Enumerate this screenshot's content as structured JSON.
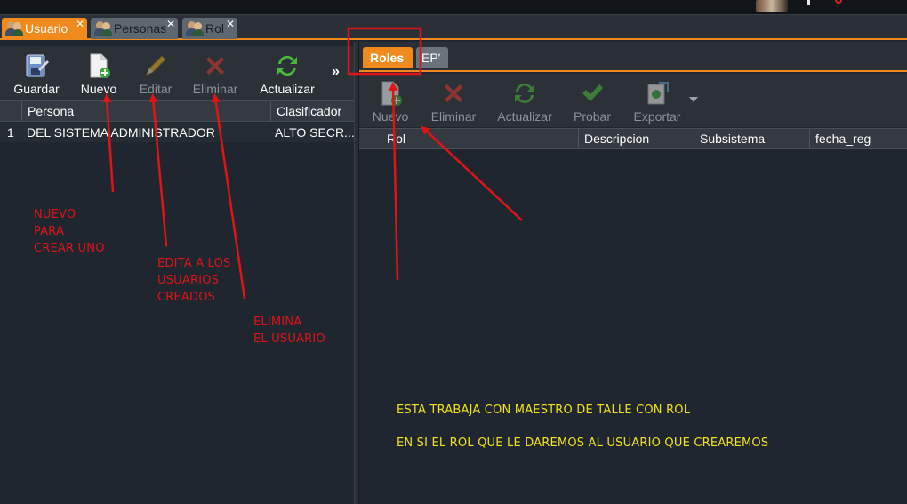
{
  "main_tabs": [
    {
      "label": "Usuario",
      "close": "✕"
    },
    {
      "label": "Personas",
      "close": "✕"
    },
    {
      "label": "Rol",
      "close": "✕"
    }
  ],
  "left_toolbar": {
    "guardar": "Guardar",
    "nuevo": "Nuevo",
    "editar": "Editar",
    "eliminar": "Eliminar",
    "actualizar": "Actualizar",
    "more": "»"
  },
  "left_grid": {
    "columns": [
      "Persona",
      "Clasificador"
    ],
    "rows": [
      {
        "num": "1",
        "persona": "DEL SISTEMA ADMINISTRADOR",
        "clasificador": "ALTO SECR..."
      }
    ]
  },
  "right_subtabs": [
    {
      "label": "Roles"
    },
    {
      "label": "EP'"
    }
  ],
  "right_toolbar": {
    "nuevo": "Nuevo",
    "eliminar": "Eliminar",
    "actualizar": "Actualizar",
    "probar": "Probar",
    "exportar": "Exportar"
  },
  "right_grid": {
    "columns": [
      "Rol",
      "Descripcion",
      "Subsistema",
      "fecha_reg"
    ]
  },
  "annotations": {
    "nuevo_lines": [
      "NUEVO",
      "PARA",
      "CREAR UNO"
    ],
    "edita_lines": [
      "EDITA A LOS",
      "USUARIOS",
      "CREADOS"
    ],
    "elimina_lines": [
      "ELIMINA",
      "EL USUARIO"
    ],
    "note_1": "ESTA TRABAJA CON MAESTRO DE TALLE CON ROL",
    "note_2": "EN SI EL ROL QUE LE DAREMOS AL USUARIO QUE CREAREMOS"
  },
  "colors": {
    "accent": "#f08a1c",
    "annotation_red": "#e01414",
    "annotation_yellow": "#f2e21a",
    "background": "#1f2630"
  }
}
